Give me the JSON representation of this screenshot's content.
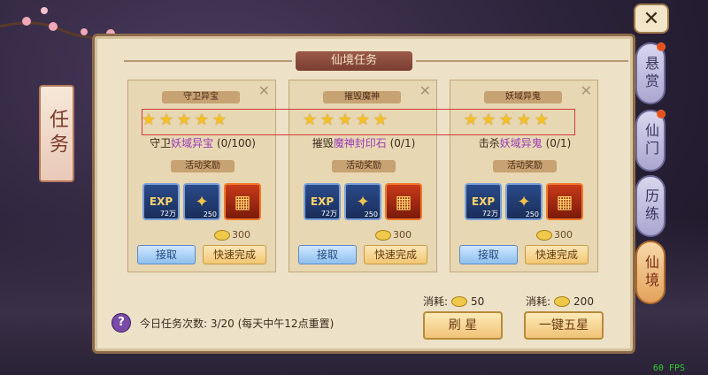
{
  "colors": {
    "highlight": "#d23a3a",
    "accent_purple": "#9b3ab8",
    "star": "#f5c026"
  },
  "close_icon": "x-icon",
  "left_banner": "任务",
  "panel": {
    "title": "仙境任务"
  },
  "tasks": [
    {
      "tag": "守卫异宝",
      "stars": 5,
      "desc_prefix": "守卫",
      "desc_highlight": "妖域异宝",
      "desc_suffix": "(0/100)",
      "reward_label": "活动奖励",
      "rewards": [
        {
          "icon": "exp-icon",
          "label": "EXP",
          "qty": "72万"
        },
        {
          "icon": "eagle-badge-icon",
          "qty": "250"
        },
        {
          "icon": "treasure-chest-icon",
          "qty": ""
        }
      ],
      "cost": "300",
      "accept_label": "接取",
      "quick_label": "快速完成"
    },
    {
      "tag": "摧毁魔神",
      "stars": 5,
      "desc_prefix": "摧毁",
      "desc_highlight": "魔神封印石",
      "desc_suffix": "(0/1)",
      "reward_label": "活动奖励",
      "rewards": [
        {
          "icon": "exp-icon",
          "label": "EXP",
          "qty": "72万"
        },
        {
          "icon": "eagle-badge-icon",
          "qty": "250"
        },
        {
          "icon": "treasure-chest-icon",
          "qty": ""
        }
      ],
      "cost": "300",
      "accept_label": "接取",
      "quick_label": "快速完成"
    },
    {
      "tag": "妖域异鬼",
      "stars": 5,
      "desc_prefix": "击杀",
      "desc_highlight": "妖域异鬼",
      "desc_suffix": "(0/1)",
      "reward_label": "活动奖励",
      "rewards": [
        {
          "icon": "exp-icon",
          "label": "EXP",
          "qty": "72万"
        },
        {
          "icon": "eagle-badge-icon",
          "qty": "250"
        },
        {
          "icon": "treasure-chest-icon",
          "qty": ""
        }
      ],
      "cost": "300",
      "accept_label": "接取",
      "quick_label": "快速完成"
    }
  ],
  "bottom": {
    "help_glyph": "?",
    "daily_text": "今日任务次数: 3/20 (每天中午12点重置)",
    "consume_label": "消耗:",
    "refresh_cost": "50",
    "refresh_label": "刷 星",
    "five_star_cost": "200",
    "five_star_label": "一键五星"
  },
  "side_tabs": [
    {
      "label": "悬赏",
      "active": false,
      "dot": true
    },
    {
      "label": "仙门",
      "active": false,
      "dot": true
    },
    {
      "label": "历练",
      "active": false,
      "dot": false
    },
    {
      "label": "仙境",
      "active": true,
      "dot": false
    }
  ],
  "fps": "60 FPS"
}
